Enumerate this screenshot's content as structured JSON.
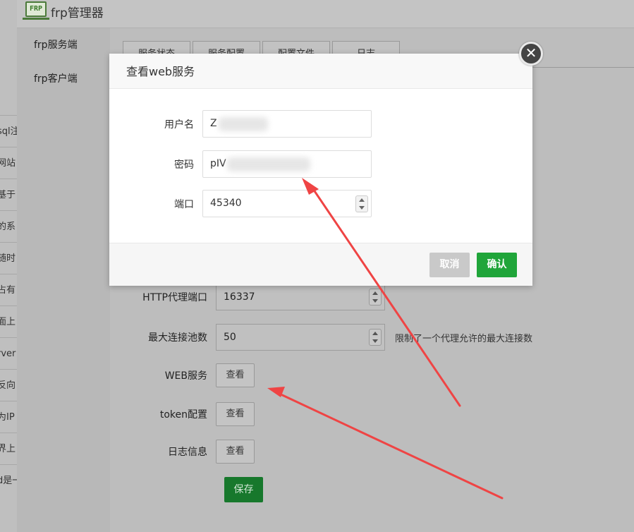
{
  "app": {
    "title": "frp管理器",
    "logo_text": "FRP"
  },
  "left_strip": [
    "sql注",
    "网站",
    "基于",
    "的系",
    "随时",
    "占有",
    "面上",
    "rver",
    "反向",
    "为IP",
    "界上",
    "d是一"
  ],
  "sidebar": {
    "items": [
      {
        "label": "frp服务端"
      },
      {
        "label": "frp客户端"
      }
    ]
  },
  "tabs": [
    "服务状态",
    "服务配置",
    "配置文件",
    "日志"
  ],
  "form": {
    "http_port": {
      "label": "HTTP代理端口",
      "value": "16337"
    },
    "max_pool": {
      "label": "最大连接池数",
      "value": "50",
      "hint": "限制了一个代理允许的最大连接数"
    },
    "web_service": {
      "label": "WEB服务",
      "button": "查看"
    },
    "token": {
      "label": "token配置",
      "button": "查看"
    },
    "log": {
      "label": "日志信息",
      "button": "查看"
    },
    "save_label": "保存"
  },
  "modal": {
    "title": "查看web服务",
    "username": {
      "label": "用户名",
      "value": "Z"
    },
    "password": {
      "label": "密码",
      "value": "pIV"
    },
    "port": {
      "label": "端口",
      "value": "45340"
    },
    "cancel_label": "取消",
    "confirm_label": "确认",
    "close_icon": "close-icon"
  },
  "colors": {
    "confirm": "#20a53a",
    "save": "#17782c",
    "annotation_arrow": "#ef4444"
  }
}
